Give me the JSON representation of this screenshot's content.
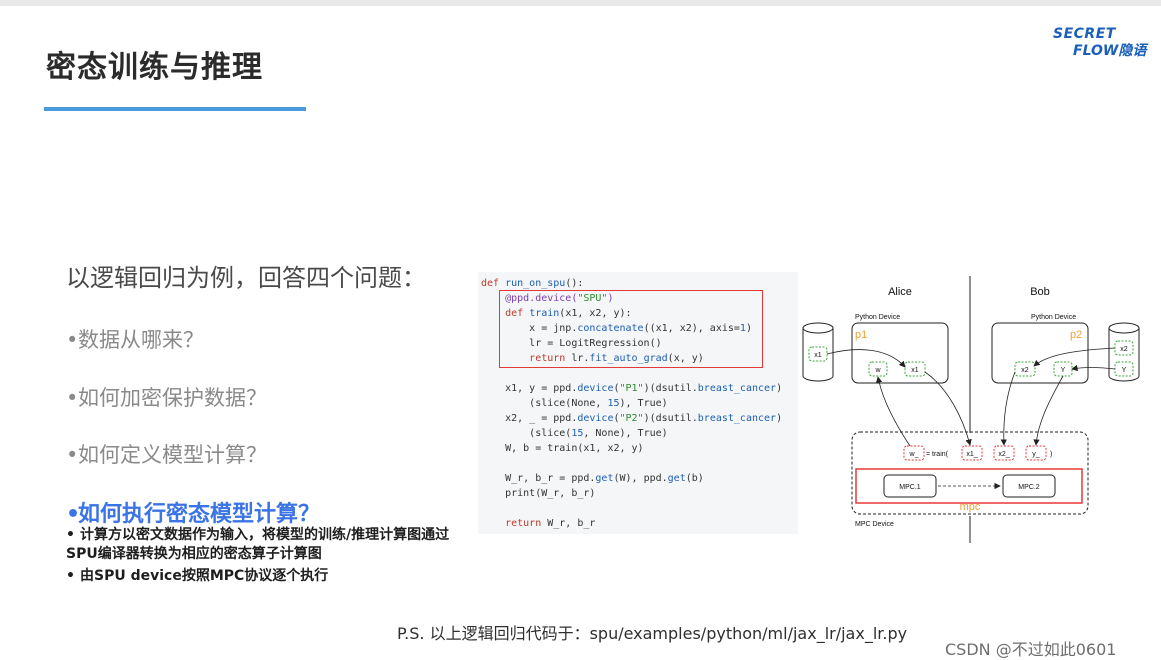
{
  "slide": {
    "title": "密态训练与推理",
    "logo": {
      "line1": "SECRET",
      "line2": "FLOW隐语"
    },
    "intro": "以逻辑回归为例，回答四个问题：",
    "questions": [
      {
        "text": "数据从哪来？"
      },
      {
        "text": "如何加密保护数据？"
      },
      {
        "text": "如何定义模型计算？"
      },
      {
        "text": "如何执行密态模型计算？"
      }
    ],
    "answers": [
      "计算方以密文数据作为输入，将模型的训练/推理计算图通过SPU编译器转换为相应的密态算子计算图",
      "由SPU device按照MPC协议逐个执行"
    ],
    "footer": "P.S. 以上逻辑回归代码于：spu/examples/python/ml/jax_lr/jax_lr.py",
    "watermark": "CSDN @不过如此0601"
  },
  "code": {
    "l1_def": "def",
    "l1_name": "run_on_spu",
    "l1_rest": "():",
    "l2_dec": "@ppd.device(",
    "l2_str": "\"SPU\"",
    "l2_end": ")",
    "l3_def": "def",
    "l3_name": "train",
    "l3_rest": "(x1, x2, y):",
    "l4_a": "x = jnp.",
    "l4_fn": "concatenate",
    "l4_b": "((x1, x2), axis=",
    "l4_num": "1",
    "l4_c": ")",
    "l5": "lr = LogitRegression()",
    "l6_kw": "return",
    "l6_a": " lr.",
    "l6_fn": "fit_auto_grad",
    "l6_b": "(x, y)",
    "l7_a": "x1, y = ppd.",
    "l7_fn": "device",
    "l7_b": "(",
    "l7_str": "\"P1\"",
    "l7_c": ")(dsutil.",
    "l7_fn2": "breast_cancer",
    "l7_d": ")",
    "l8_a": "(slice(None, ",
    "l8_num": "15",
    "l8_b": "), True)",
    "l9_a": "x2, _ = ppd.",
    "l9_fn": "device",
    "l9_b": "(",
    "l9_str": "\"P2\"",
    "l9_c": ")(dsutil.",
    "l9_fn2": "breast_cancer",
    "l9_d": ")",
    "l10_a": "(slice(",
    "l10_num": "15",
    "l10_b": ", None), True)",
    "l11": "W, b = train(x1, x2, y)",
    "l12_a": "W_r, b_r = ppd.",
    "l12_fn": "get",
    "l12_b": "(W), ppd.",
    "l12_fn2": "get",
    "l12_c": "(b)",
    "l13": "print(W_r, b_r)",
    "l14_kw": "return",
    "l14_a": " W_r, b_r"
  },
  "diagram": {
    "alice": "Alice",
    "bob": "Bob",
    "python_device_left": "Python Device",
    "python_device_right": "Python Device",
    "p1": "p1",
    "p2": "p2",
    "x1_db": "x1",
    "w_node": "w",
    "x1_node": "x1",
    "x2_node": "x2",
    "y_node": "Y",
    "x2_db": "x2",
    "y_db": "Y",
    "train_w": "w_",
    "train_eq": "= train(",
    "train_x1": "x1_",
    "train_x2": "x2_",
    "train_y": "y_",
    "train_close": ")",
    "mpc1": "MPC.1",
    "mpc2": "MPC.2",
    "mpc_label": "mpc",
    "mpc_device": "MPC Device"
  }
}
